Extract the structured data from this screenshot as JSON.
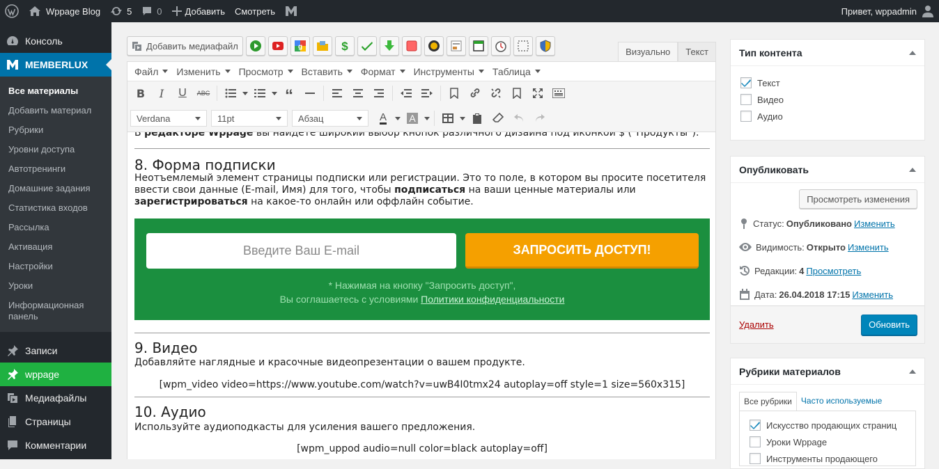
{
  "adminbar": {
    "site_name": "Wppage Blog",
    "updates_count": "5",
    "comments_count": "0",
    "add_label": "Добавить",
    "view_label": "Смотреть",
    "greeting": "Привет, wppadmin"
  },
  "sidebar": {
    "console": "Консоль",
    "memberlux": "MEMBERLUX",
    "submenu": [
      "Все материалы",
      "Добавить материал",
      "Рубрики",
      "Уровни доступа",
      "Автотренинги",
      "Домашние задания",
      "Статистика входов",
      "Рассылка",
      "Активация",
      "Настройки",
      "Уроки",
      "Информационная панель"
    ],
    "posts": "Записи",
    "wppage": "wppage",
    "media": "Медиафайлы",
    "pages": "Страницы",
    "comments": "Комментарии"
  },
  "editor": {
    "add_media": "Добавить медиафайл",
    "tab_visual": "Визуально",
    "tab_text": "Текст",
    "menu": [
      "Файл",
      "Изменить",
      "Просмотр",
      "Вставить",
      "Формат",
      "Инструменты",
      "Таблица"
    ],
    "font_family": "Verdana",
    "font_size": "11pt",
    "block_format": "Абзац"
  },
  "content": {
    "cut_line_prefix": "В ",
    "cut_line_bold": "редакторе Wppage",
    "cut_line_rest": " вы найдете широкий выбор кнопок различного дизайна под иконкой $ (\"Продукты\").",
    "h8": "8. Форма подписки",
    "p8_a": "Неотъемлемый элемент страницы подписки или регистрации. Это то  поле, в котором вы просите посетителя ввести свои данные (E-mail, Имя) для того, чтобы ",
    "p8_b": "подписаться",
    "p8_c": " на ваши ценные материалы или ",
    "p8_d": "зарегистрироваться",
    "p8_e": " на какое-то онлайн или оффлайн событие.",
    "banner_input": "Введите Ваш E-mail",
    "banner_button": "ЗАПРОСИТЬ ДОСТУП!",
    "banner_note1": "* Нажимая на кнопку \"Запросить доступ\",",
    "banner_note2": "Вы соглашаетесь с условиями ",
    "banner_note_link": "Политики конфиденциальности",
    "h9": "9. Видео",
    "p9": "Добавляйте наглядные и красочные видеопрезентации о вашем продукте.",
    "sc9": "[wpm_video video=https://www.youtube.com/watch?v=uwB4I0tmx24 autoplay=off style=1 size=560x315]",
    "h10": "10. Аудио",
    "p10": "Используйте аудиоподкасты для усиления вашего предложения.",
    "sc10": "[wpm_uppod audio=null color=black autoplay=off]"
  },
  "content_type_box": {
    "title": "Тип контента",
    "options": [
      {
        "label": "Текст",
        "checked": true
      },
      {
        "label": "Видео",
        "checked": false
      },
      {
        "label": "Аудио",
        "checked": false
      }
    ]
  },
  "publish_box": {
    "title": "Опубликовать",
    "preview_changes": "Просмотреть изменения",
    "status_label": "Статус:",
    "status_value": "Опубликовано",
    "visibility_label": "Видимость:",
    "visibility_value": "Открыто",
    "revisions_label": "Редакции:",
    "revisions_value": "4",
    "date_label": "Дата:",
    "date_value": "26.04.2018 17:15",
    "edit_link": "Изменить",
    "view_link": "Просмотреть",
    "delete_link": "Удалить",
    "update_button": "Обновить"
  },
  "categories_box": {
    "title": "Рубрики материалов",
    "tab_all": "Все рубрики",
    "tab_popular": "Часто используемые",
    "items": [
      {
        "label": "Искусство продающих страниц",
        "checked": true
      },
      {
        "label": "Уроки Wppage",
        "checked": false
      },
      {
        "label": "Инструменты продающего",
        "checked": false
      }
    ]
  }
}
